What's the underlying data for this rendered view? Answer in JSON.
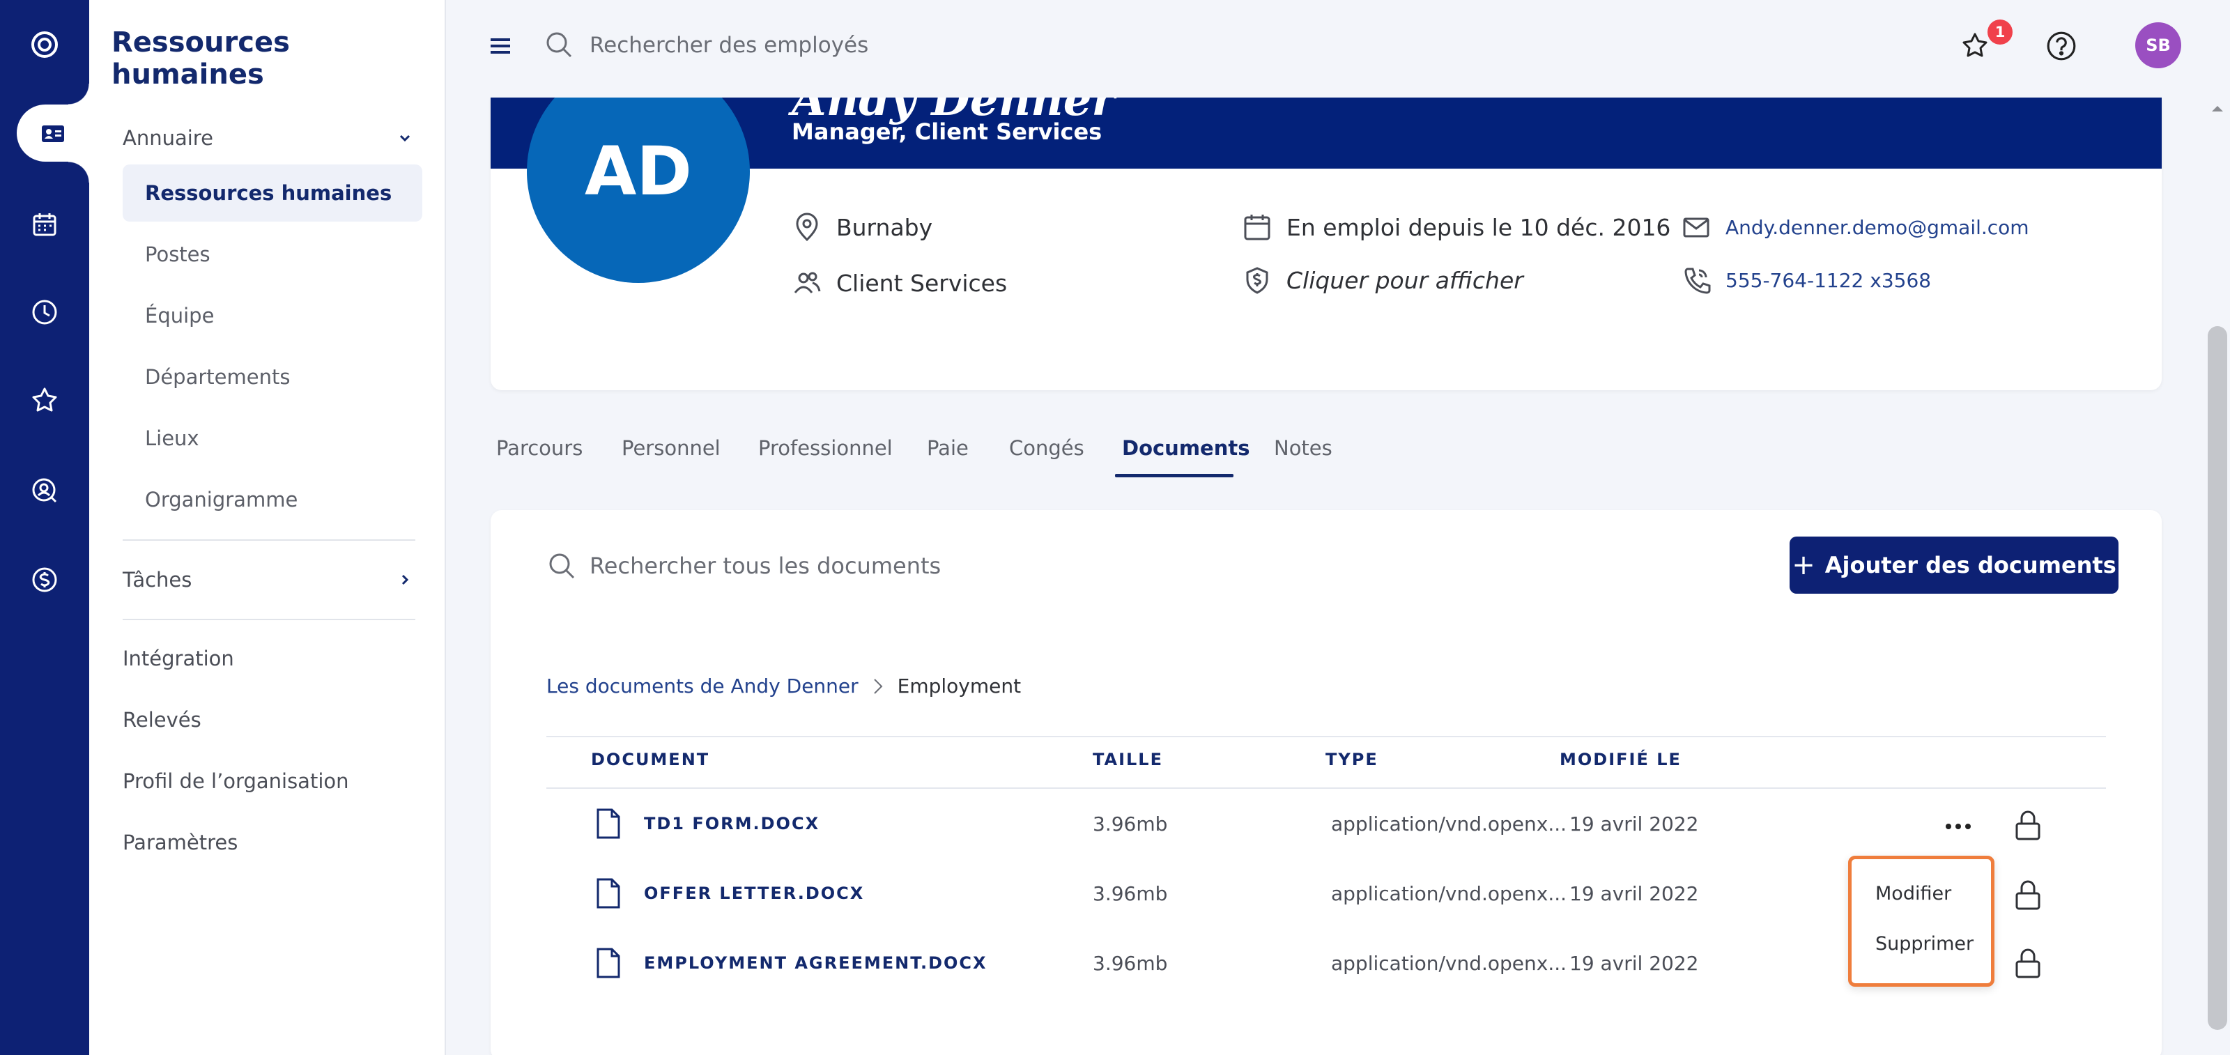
{
  "colors": {
    "navy": "#0d2174",
    "banner": "#03217a",
    "avatar_bg": "#0667b8",
    "user_avatar": "#9a4fc1",
    "badge": "#f0414b",
    "menu_border": "#ef7d3c"
  },
  "rail": {
    "icons": [
      "app-logo-icon",
      "directory-card-icon",
      "calendar-icon",
      "clock-icon",
      "star-icon",
      "search-user-icon",
      "dollar-icon"
    ]
  },
  "sidebar": {
    "title": "Ressources humaines",
    "annuaire": "Annuaire",
    "items": [
      {
        "label": "Ressources humaines",
        "active": true
      },
      {
        "label": "Postes"
      },
      {
        "label": "Équipe"
      },
      {
        "label": "Départements"
      },
      {
        "label": "Lieux"
      },
      {
        "label": "Organigramme"
      }
    ],
    "taches": "Tâches",
    "links": [
      "Intégration",
      "Relevés",
      "Profil de l’organisation",
      "Paramètres"
    ]
  },
  "topbar": {
    "search_placeholder": "Rechercher des employés",
    "badge_count": "1",
    "user_initials": "SB"
  },
  "profile": {
    "name": "Andy Denner",
    "role": "Manager, Client Services",
    "initials": "AD",
    "location": "Burnaby",
    "department": "Client Services",
    "employed_since": "En emploi depuis le 10 déc. 2016",
    "salary_hidden": "Cliquer pour afficher",
    "email": "Andy.denner.demo@gmail.com",
    "phone": "555-764-1122 x3568"
  },
  "tabs": [
    "Parcours",
    "Personnel",
    "Professionnel",
    "Paie",
    "Congés",
    "Documents",
    "Notes"
  ],
  "active_tab": "Documents",
  "documents": {
    "search_placeholder": "Rechercher tous les documents",
    "add_button": "Ajouter des documents",
    "breadcrumb": {
      "root": "Les documents de Andy Denner",
      "current": "Employment"
    },
    "columns": {
      "document": "DOCUMENT",
      "size": "TAILLE",
      "type": "TYPE",
      "modified": "MODIFIÉ LE"
    },
    "rows": [
      {
        "name": "TD1 FORM.DOCX",
        "size": "3.96mb",
        "type": "application/vnd.openx...",
        "modified": "19 avril 2022"
      },
      {
        "name": "OFFER LETTER.DOCX",
        "size": "3.96mb",
        "type": "application/vnd.openx...",
        "modified": "19 avril 2022"
      },
      {
        "name": "EMPLOYMENT AGREEMENT.DOCX",
        "size": "3.96mb",
        "type": "application/vnd.openx...",
        "modified": "19 avril 2022"
      }
    ]
  },
  "context_menu": {
    "edit": "Modifier",
    "delete": "Supprimer"
  }
}
